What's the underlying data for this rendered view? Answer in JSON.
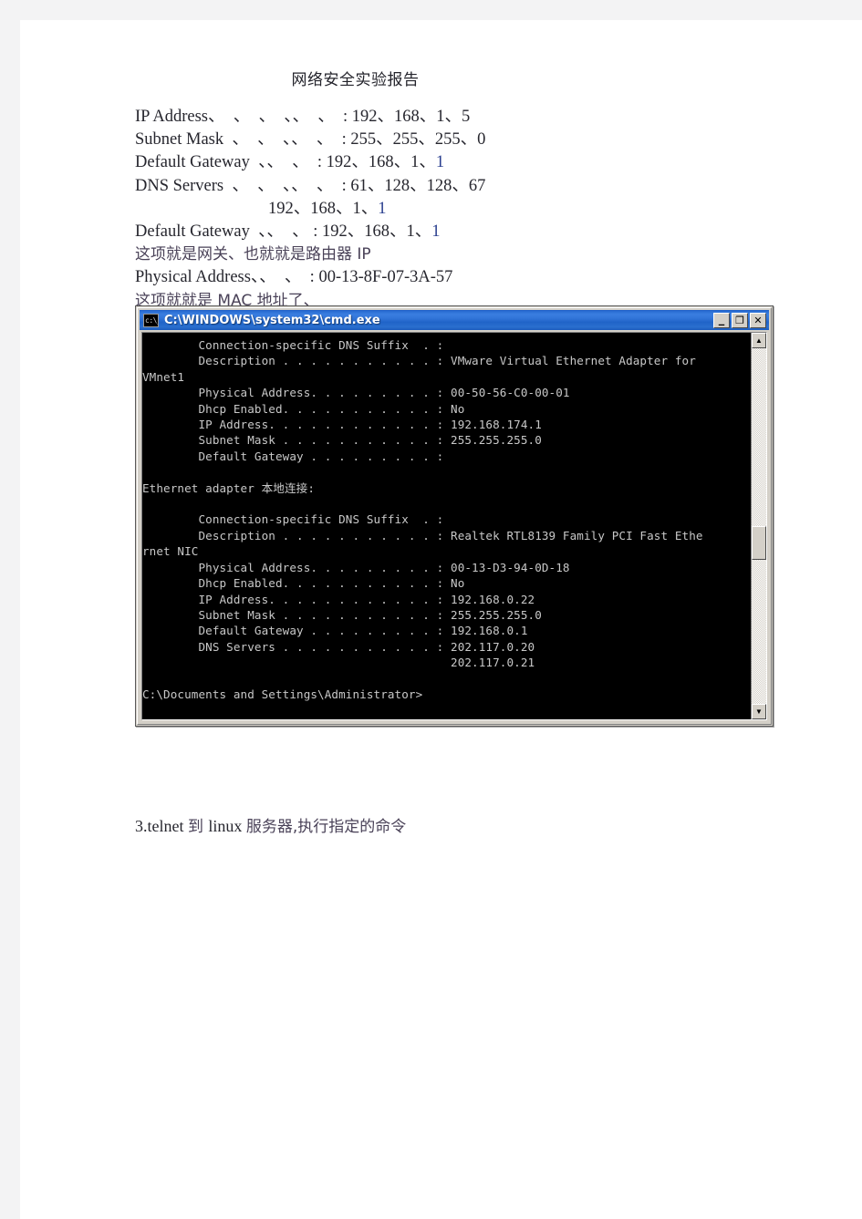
{
  "document": {
    "title": "网络安全实验报告",
    "lines": [
      {
        "text": "IP Address、  、  、  、、  、  : 192、168、1、5",
        "style": "latin"
      },
      {
        "text": "Subnet Mask  、  、  、、  、  : 255、255、255、0",
        "style": "latin"
      },
      {
        "text": "Default Gateway  、、  、  : 192、168、1、",
        "tail": "1",
        "style": "latin-blue-tail"
      },
      {
        "text": "DNS Servers  、  、  、、  、  : 61、128、128、67",
        "style": "latin"
      },
      {
        "text": "192、168、1、",
        "tail": "1",
        "style": "latin-blue-tail-indent"
      },
      {
        "text": "Default Gateway  、、  、 : 192、168、1、",
        "tail": "1",
        "style": "latin-blue-tail"
      },
      {
        "text": "这项就是网关、也就就是路由器 IP",
        "style": "cn"
      },
      {
        "text": "Physical Address、、  、  : 00-13-8F-07-3A-57",
        "style": "latin"
      },
      {
        "text": "这项就就是 MAC 地址了、",
        "style": "cn"
      }
    ],
    "trailing_note_prefix": "3.telnet ",
    "trailing_note": "到 linux 服务器,执行指定的命令",
    "trailing_note_mid": "linux ",
    "trailing_note_a": "到 ",
    "trailing_note_b": "服务器,执行指定的命令"
  },
  "cmd_window": {
    "title": "C:\\WINDOWS\\system32\\cmd.exe",
    "icon": "cmd-icon",
    "buttons": {
      "minimize": "_",
      "maximize": "❐",
      "close": "✕"
    },
    "scrollbar": {
      "up_arrow": "▲",
      "down_arrow": "▼"
    },
    "console_lines": [
      "        Connection-specific DNS Suffix  . :",
      "        Description . . . . . . . . . . . : VMware Virtual Ethernet Adapter for",
      "VMnet1",
      "        Physical Address. . . . . . . . . : 00-50-56-C0-00-01",
      "        Dhcp Enabled. . . . . . . . . . . : No",
      "        IP Address. . . . . . . . . . . . : 192.168.174.1",
      "        Subnet Mask . . . . . . . . . . . : 255.255.255.0",
      "        Default Gateway . . . . . . . . . :",
      "",
      "Ethernet adapter 本地连接:",
      "",
      "        Connection-specific DNS Suffix  . :",
      "        Description . . . . . . . . . . . : Realtek RTL8139 Family PCI Fast Ethe",
      "rnet NIC",
      "        Physical Address. . . . . . . . . : 00-13-D3-94-0D-18",
      "        Dhcp Enabled. . . . . . . . . . . : No",
      "        IP Address. . . . . . . . . . . . : 192.168.0.22",
      "        Subnet Mask . . . . . . . . . . . : 255.255.255.0",
      "        Default Gateway . . . . . . . . . : 192.168.0.1",
      "        DNS Servers . . . . . . . . . . . : 202.117.0.20",
      "                                            202.117.0.21",
      "",
      "C:\\Documents and Settings\\Administrator>"
    ]
  },
  "colors": {
    "page_margin": "#f3f3f4",
    "page": "#ffffff",
    "titlebar_blue": "#2b6fd4",
    "console_bg": "#000000",
    "console_fg": "#c8c8c8",
    "chrome": "#d4d0c8",
    "accent_blue_text": "#2a3f8f"
  }
}
